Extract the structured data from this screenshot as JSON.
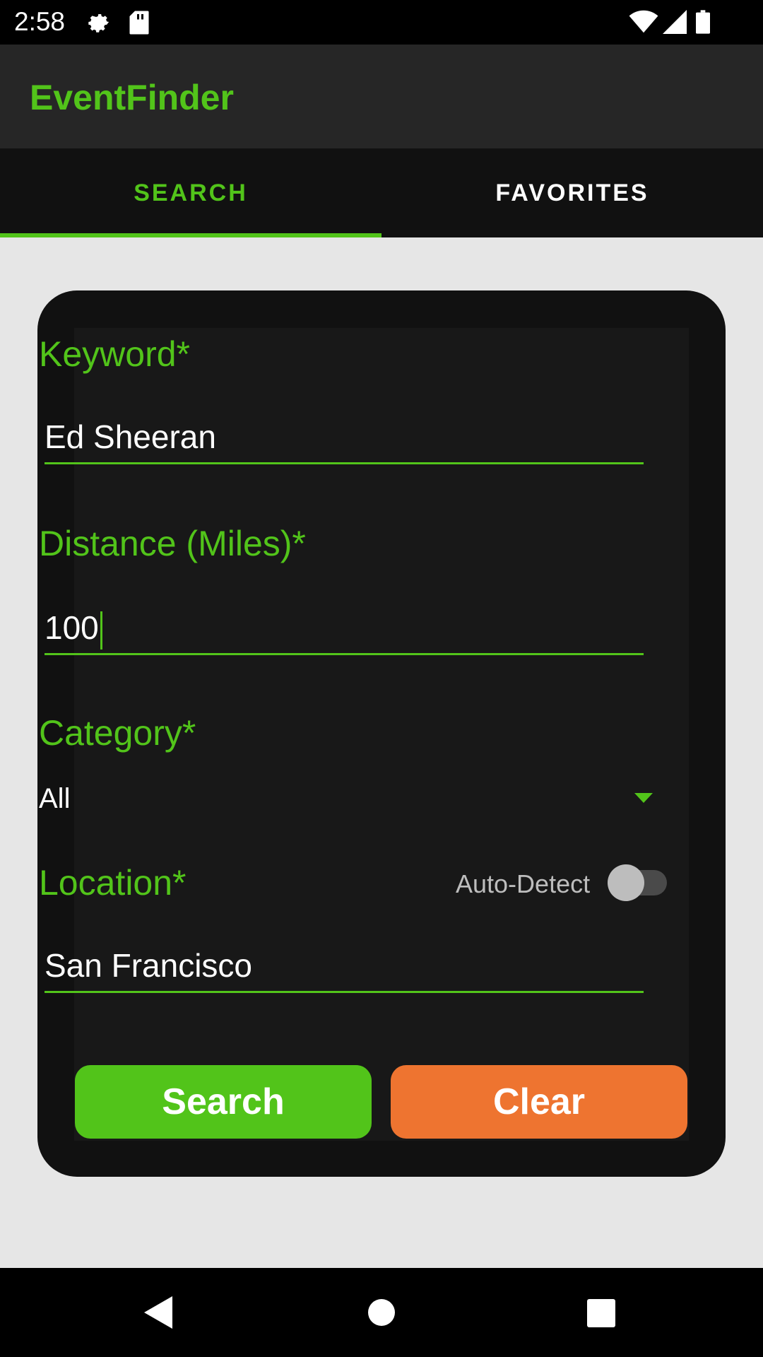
{
  "status_bar": {
    "time": "2:58",
    "icons": [
      "settings-icon",
      "sd-card-icon",
      "wifi-icon",
      "signal-icon",
      "battery-icon"
    ]
  },
  "app": {
    "title": "EventFinder",
    "accent_color": "#52c41a"
  },
  "tabs": [
    {
      "label": "SEARCH",
      "selected": true
    },
    {
      "label": "FAVORITES",
      "selected": false
    }
  ],
  "form": {
    "keyword": {
      "label": "Keyword*",
      "value": "Ed Sheeran"
    },
    "distance": {
      "label": "Distance (Miles)*",
      "value": "100"
    },
    "category": {
      "label": "Category*",
      "value": "All"
    },
    "location": {
      "label": "Location*",
      "value": "San Francisco",
      "auto_detect_label": "Auto-Detect",
      "auto_detect_on": false
    }
  },
  "buttons": {
    "search_label": "Search",
    "clear_label": "Clear",
    "search_color": "#52c41a",
    "clear_color": "#ee7430"
  },
  "nav_bar": {
    "icons": [
      "back-icon",
      "home-icon",
      "recents-icon"
    ]
  }
}
